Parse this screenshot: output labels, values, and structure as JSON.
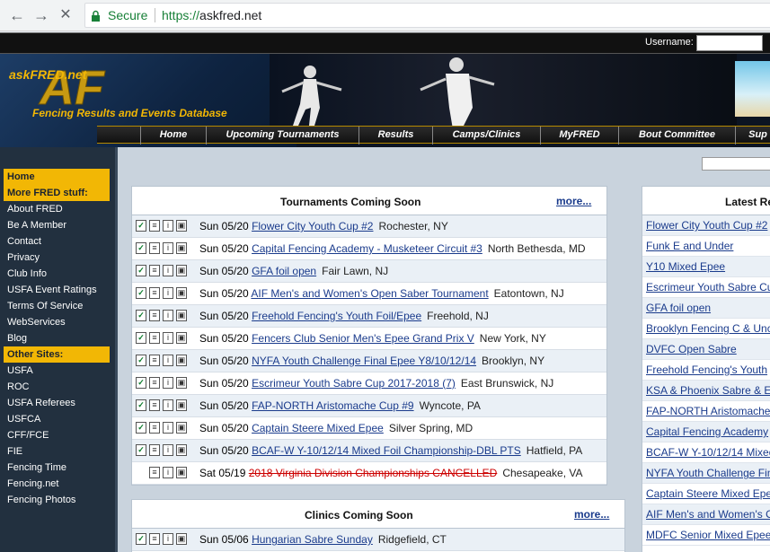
{
  "browser": {
    "secure_label": "Secure",
    "url_protocol": "https://",
    "url_host": "askfred.net",
    "icons": [
      "back-arrow-icon",
      "forward-arrow-icon",
      "stop-icon",
      "lock-icon"
    ]
  },
  "header": {
    "username_label": "Username:",
    "logo_name": "askFRED.net",
    "logo_tagline": "Fencing Results and Events Database"
  },
  "nav": [
    "Home",
    "Upcoming Tournaments",
    "Results",
    "Camps/Clinics",
    "MyFRED",
    "Bout Committee",
    "Sup"
  ],
  "sidebar": {
    "items": [
      {
        "label": "Home",
        "highlight": true
      },
      {
        "label": "More FRED stuff:",
        "highlight": true
      },
      {
        "label": "About FRED",
        "highlight": false
      },
      {
        "label": "Be A Member",
        "highlight": false
      },
      {
        "label": "Contact",
        "highlight": false
      },
      {
        "label": "Privacy",
        "highlight": false
      },
      {
        "label": "Club Info",
        "highlight": false
      },
      {
        "label": "USFA Event Ratings",
        "highlight": false
      },
      {
        "label": "Terms Of Service",
        "highlight": false
      },
      {
        "label": "WebServices",
        "highlight": false
      },
      {
        "label": "Blog",
        "highlight": false
      },
      {
        "label": "Other Sites:",
        "highlight": true
      },
      {
        "label": "USFA",
        "highlight": false
      },
      {
        "label": "ROC",
        "highlight": false
      },
      {
        "label": "USFA Referees",
        "highlight": false
      },
      {
        "label": "USFCA",
        "highlight": false
      },
      {
        "label": "CFF/FCE",
        "highlight": false
      },
      {
        "label": "FIE",
        "highlight": false
      },
      {
        "label": "Fencing Time",
        "highlight": false
      },
      {
        "label": "Fencing.net",
        "highlight": false
      },
      {
        "label": "Fencing Photos",
        "highlight": false
      }
    ]
  },
  "tournaments": {
    "title": "Tournaments Coming Soon",
    "more": "more...",
    "rows": [
      {
        "date": "Sun 05/20",
        "name": "Flower City Youth Cup #2",
        "location": "Rochester, NY",
        "checkbox": true,
        "cancelled": false
      },
      {
        "date": "Sun 05/20",
        "name": "Capital Fencing Academy - Musketeer Circuit #3",
        "location": "North Bethesda, MD",
        "checkbox": true,
        "cancelled": false
      },
      {
        "date": "Sun 05/20",
        "name": "GFA foil open",
        "location": "Fair Lawn, NJ",
        "checkbox": true,
        "cancelled": false
      },
      {
        "date": "Sun 05/20",
        "name": "AIF Men's and Women's Open Saber Tournament",
        "location": "Eatontown, NJ",
        "checkbox": true,
        "cancelled": false
      },
      {
        "date": "Sun 05/20",
        "name": "Freehold Fencing's Youth Foil/Epee",
        "location": "Freehold, NJ",
        "checkbox": true,
        "cancelled": false
      },
      {
        "date": "Sun 05/20",
        "name": "Fencers Club Senior Men's Epee Grand Prix V",
        "location": "New York, NY",
        "checkbox": true,
        "cancelled": false
      },
      {
        "date": "Sun 05/20",
        "name": "NYFA Youth Challenge Final Epee Y8/10/12/14",
        "location": "Brooklyn, NY",
        "checkbox": true,
        "cancelled": false
      },
      {
        "date": "Sun 05/20",
        "name": "Escrimeur Youth Sabre Cup 2017-2018 (7)",
        "location": "East Brunswick, NJ",
        "checkbox": true,
        "cancelled": false
      },
      {
        "date": "Sun 05/20",
        "name": "FAP-NORTH Aristomache Cup #9",
        "location": "Wyncote, PA",
        "checkbox": true,
        "cancelled": false
      },
      {
        "date": "Sun 05/20",
        "name": "Captain Steere Mixed Epee",
        "location": "Silver Spring, MD",
        "checkbox": true,
        "cancelled": false
      },
      {
        "date": "Sun 05/20",
        "name": "BCAF-W Y-10/12/14 Mixed Foil Championship-DBL PTS",
        "location": "Hatfield, PA",
        "checkbox": true,
        "cancelled": false
      },
      {
        "date": "Sat 05/19",
        "name": "2018 Virginia Division Championships CANCELLED",
        "location": "Chesapeake, VA",
        "checkbox": false,
        "cancelled": true
      }
    ]
  },
  "clinics": {
    "title": "Clinics Coming Soon",
    "more": "more...",
    "rows": [
      {
        "date": "Sun 05/06",
        "name": "Hungarian Sabre Sunday",
        "location": "Ridgefield, CT"
      }
    ]
  },
  "latest": {
    "title": "Latest Re",
    "links": [
      "Flower City Youth Cup #2",
      "Funk E and Under",
      "Y10 Mixed Epee",
      "Escrimeur Youth Sabre Cu",
      "GFA foil open",
      "Brooklyn Fencing C & Unc",
      "DVFC Open Sabre",
      "Freehold Fencing's Youth",
      "KSA & Phoenix Sabre & E",
      "FAP-NORTH Aristomache",
      "Capital Fencing Academy",
      "BCAF-W Y-10/12/14 Mixed",
      "NYFA Youth Challenge Fin",
      "Captain Steere Mixed Epe",
      "AIF Men's and Women's O",
      "MDFC Senior Mixed Epee"
    ]
  },
  "colors": {
    "accent": "#f2b705",
    "link": "#1a3b8c",
    "sidebar": "#22303f"
  }
}
